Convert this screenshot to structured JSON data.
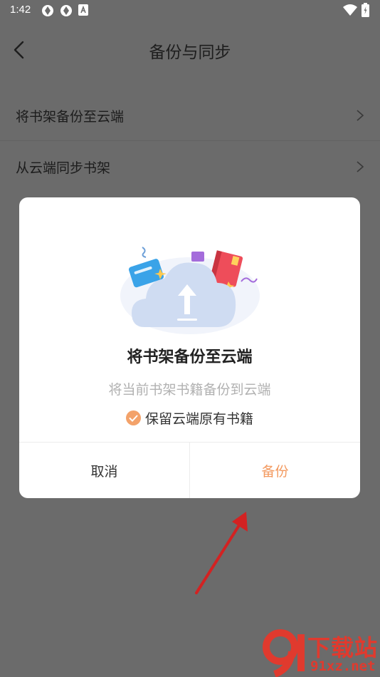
{
  "status_bar": {
    "time": "1:42"
  },
  "nav": {
    "title": "备份与同步"
  },
  "settings": {
    "items": [
      {
        "label": "将书架备份至云端"
      },
      {
        "label": "从云端同步书架"
      }
    ]
  },
  "dialog": {
    "title": "将书架备份至云端",
    "subtitle": "将当前书架书籍备份到云端",
    "keep_option": {
      "label": "保留云端原有书籍",
      "checked": true
    },
    "cancel_label": "取消",
    "confirm_label": "备份"
  },
  "watermark": {
    "title": "下载站",
    "url": "91xz.net"
  },
  "colors": {
    "accent": "#f39a60",
    "overlay": "#6b6b6b",
    "annotation": "#d32222"
  }
}
